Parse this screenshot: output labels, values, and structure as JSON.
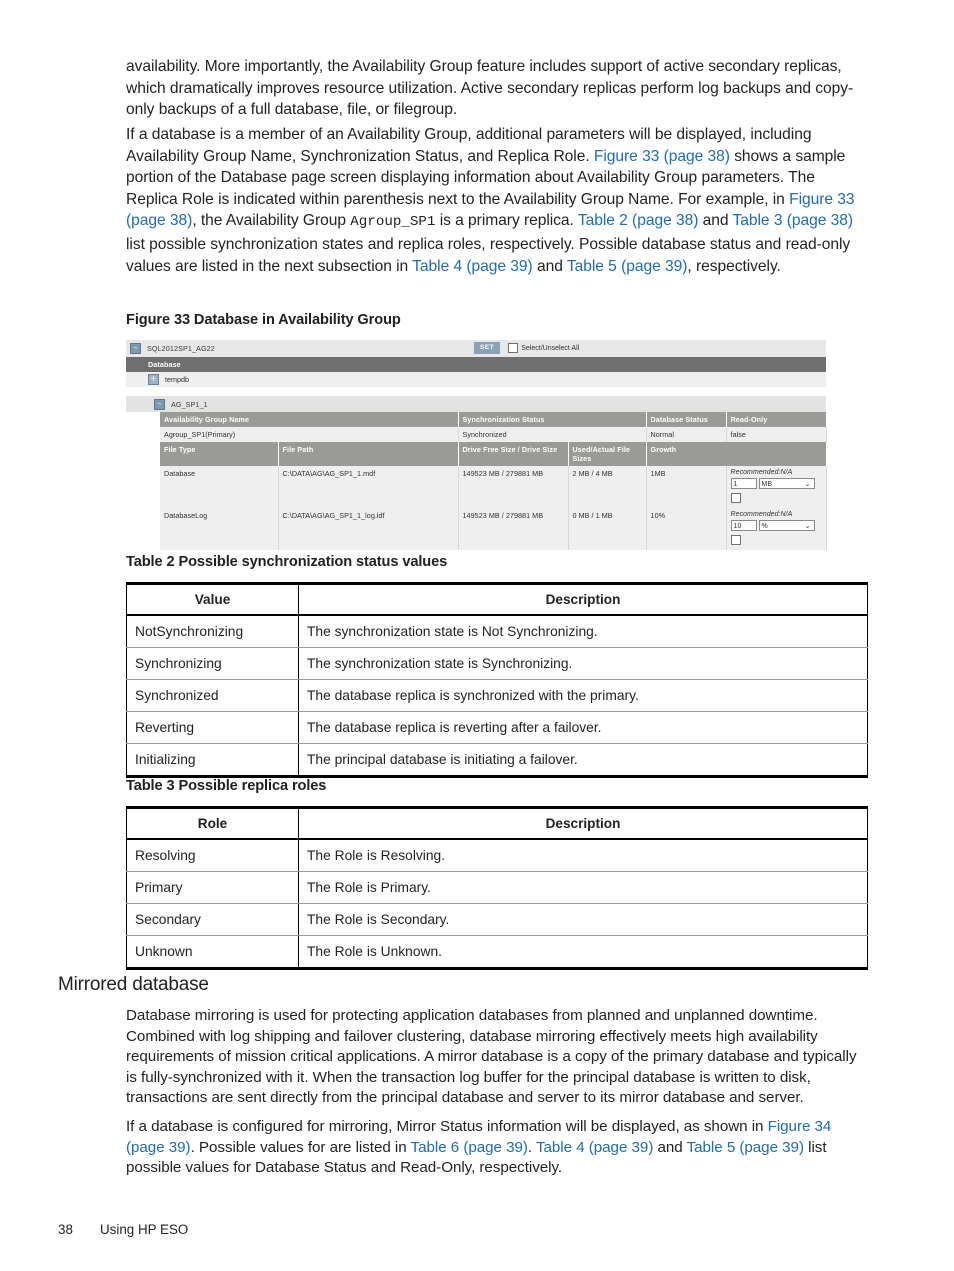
{
  "paragraphs": {
    "p1": "availability. More importantly, the Availability Group feature includes support of active secondary replicas, which dramatically improves resource utilization. Active secondary replicas perform log backups and copy-only backups of a full database, file, or filegroup.",
    "p2_a": "If a database is a member of an Availability Group, additional parameters will be displayed, including Availability Group Name, Synchronization Status, and Replica Role. ",
    "p2_link1": "Figure 33 (page 38)",
    "p2_b": " shows a sample portion of the Database page screen displaying information about Availability Group parameters. The Replica Role is indicated within parenthesis next to the Availability Group Name. For example, in ",
    "p2_link2": "Figure 33 (page 38)",
    "p2_c": ", the Availability Group ",
    "p2_mono": "Agroup_SP1",
    "p2_d": " is a primary replica. ",
    "p2_link3": "Table 2 (page 38)",
    "p2_e": " and ",
    "p2_link4": "Table 3 (page 38)",
    "p2_f": " list possible synchronization states and replica roles, respectively. Possible database status and read-only values are listed in the next subsection in ",
    "p2_link5": "Table 4 (page 39)",
    "p2_g": " and ",
    "p2_link6": "Table 5 (page 39)",
    "p2_h": ", respectively."
  },
  "figure": {
    "caption": "Figure 33 Database in Availability Group",
    "server_name": "SQL2012SP1_AG22",
    "collapse_icon": "–",
    "expand_icon": "+",
    "set_button": "SET",
    "select_all_label": "Select/Unselect All",
    "database_header": "Database",
    "tempdb_row": "tempdb",
    "ag_node": "AG_SP1_1",
    "ag_headers": [
      "Availability Group Name",
      "Synchronization Status",
      "Database Status",
      "Read-Only"
    ],
    "ag_values": [
      "Agroup_SP1(Primary)",
      "Synchronized",
      "Normal",
      "false"
    ],
    "file_headers": [
      "File Type",
      "File Path",
      "Drive Free Size / Drive Size",
      "Used/Actual File Sizes",
      "Growth",
      ""
    ],
    "file_rows": [
      {
        "type": "Database",
        "path": "C:\\DATA\\AG\\AG_SP1_1.mdf",
        "drive": "149523 MB / 279881 MB",
        "used": "2 MB / 4 MB",
        "growth": "1MB",
        "recommended": "Recommended:N/A",
        "num": "1",
        "unit": "MB",
        "caret": "⌄"
      },
      {
        "type": "DatabaseLog",
        "path": "C:\\DATA\\AG\\AG_SP1_1_log.ldf",
        "drive": "149523 MB / 279881 MB",
        "used": "0 MB / 1 MB",
        "growth": "10%",
        "recommended": "Recommended:N/A",
        "num": "10",
        "unit": "%",
        "caret": "⌄"
      }
    ]
  },
  "table2": {
    "caption": "Table 2 Possible synchronization status values",
    "headers": [
      "Value",
      "Description"
    ],
    "rows": [
      [
        "NotSynchronizing",
        "The synchronization state is Not Synchronizing."
      ],
      [
        "Synchronizing",
        "The synchronization state is Synchronizing."
      ],
      [
        "Synchronized",
        "The database replica is synchronized with the primary."
      ],
      [
        "Reverting",
        "The database replica is reverting after a failover."
      ],
      [
        "Initializing",
        "The principal database is initiating a failover."
      ]
    ]
  },
  "table3": {
    "caption": "Table 3 Possible replica roles",
    "headers": [
      "Role",
      "Description"
    ],
    "rows": [
      [
        "Resolving",
        "The Role is Resolving."
      ],
      [
        "Primary",
        "The Role is Primary."
      ],
      [
        "Secondary",
        "The Role is Secondary."
      ],
      [
        "Unknown",
        "The Role is Unknown."
      ]
    ]
  },
  "mirrored": {
    "heading": "Mirrored database",
    "p1": "Database mirroring is used for protecting application databases from planned and unplanned downtime. Combined with log shipping and failover clustering, database mirroring effectively meets high availability requirements of mission critical applications. A mirror database is a copy of the primary database and typically is fully-synchronized with it. When the transaction log buffer for the principal database is written to disk, transactions are sent directly from the principal database and server to its mirror database and server.",
    "p2_a": "If a database is configured for mirroring, Mirror Status information will be displayed, as shown in ",
    "p2_link1": "Figure 34 (page 39)",
    "p2_b": ". Possible values for are listed in ",
    "p2_link2": "Table 6 (page 39)",
    "p2_c": ". ",
    "p2_link3": "Table 4 (page 39)",
    "p2_d": " and ",
    "p2_link4": "Table 5 (page 39)",
    "p2_e": " list possible values for Database Status and Read-Only, respectively."
  },
  "footer": {
    "page_number": "38",
    "chapter": "Using HP ESO"
  },
  "colors": {
    "link": "#1f6cb0",
    "text": "#231f20",
    "fig_header_gray": "#6f6f6f",
    "fig_table_header": "#9a9a96",
    "set_button_blue": "#8aa2b8"
  }
}
